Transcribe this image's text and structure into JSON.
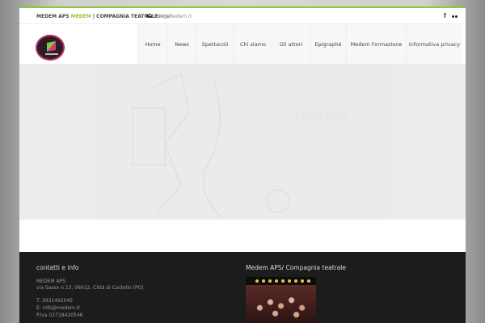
{
  "topbar": {
    "brand_prefix": "MEDEM APS ",
    "brand_highlight": "MEDEM",
    "brand_suffix": " | COMPAGNIA TEATRALE",
    "email_label": "email:",
    "email": "info@medem.it",
    "social_icons": [
      "facebook-icon",
      "flickr-icon"
    ]
  },
  "nav": {
    "items": [
      {
        "label": "Home"
      },
      {
        "label": "News"
      },
      {
        "label": "Spettacoli"
      },
      {
        "label": "Chi siamo"
      },
      {
        "label": "Gli attori"
      },
      {
        "label": "Epigraphè"
      },
      {
        "label": "Medem Formazione"
      },
      {
        "label": "Informativa privacy"
      }
    ]
  },
  "hero": {
    "text": "Spettacoli"
  },
  "footer": {
    "contacts": {
      "title": "contatti e info",
      "name": "MEDEM APS",
      "address": "via Sasso n.13, 06012, Città di Castello (PG)",
      "phone": "T:  3931492045",
      "email": "E:  info@medem.it",
      "piva": "P.Iva 02718420546"
    },
    "company": {
      "title": "Medem APS/ Compagnia teatrale"
    }
  },
  "colors": {
    "accent": "#8cc63f",
    "footer_bg": "#1c1c1c",
    "logo_ring": "#c0285a"
  }
}
